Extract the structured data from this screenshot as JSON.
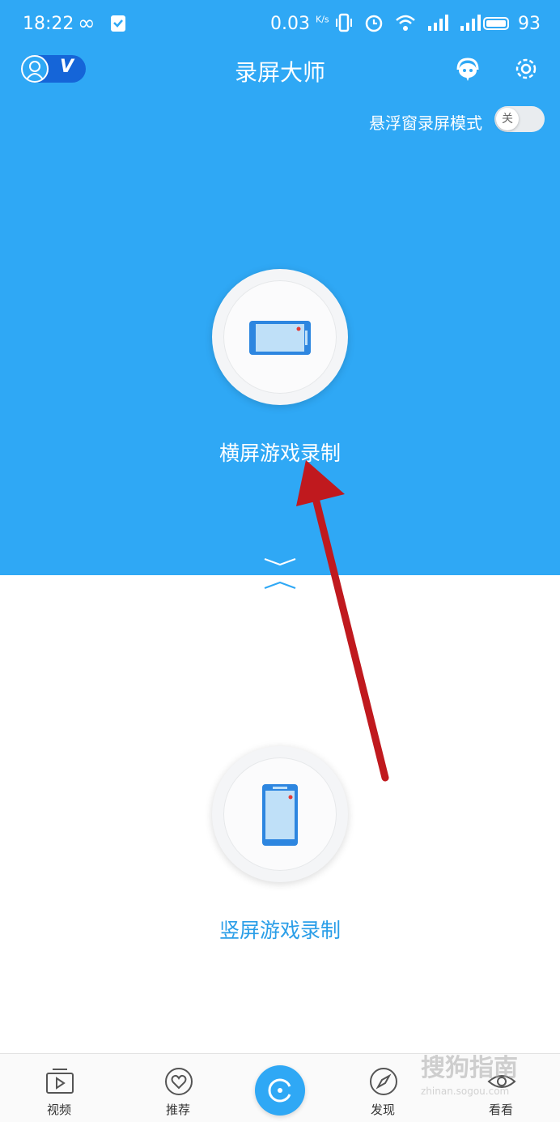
{
  "status_bar": {
    "time": "18:22",
    "speed": "0.03",
    "speed_unit": "K/s",
    "battery": "93"
  },
  "header": {
    "title": "录屏大师",
    "vip_badge": "V"
  },
  "float_mode": {
    "label": "悬浮窗录屏模式",
    "switch_state": "关"
  },
  "record": {
    "landscape_label": "横屏游戏录制",
    "portrait_label": "竖屏游戏录制"
  },
  "bottom_nav": {
    "items": [
      {
        "label": "视频",
        "icon": "video-icon"
      },
      {
        "label": "推荐",
        "icon": "heart-icon"
      },
      {
        "label": "",
        "icon": "record-icon"
      },
      {
        "label": "发现",
        "icon": "compass-icon"
      },
      {
        "label": "看看",
        "icon": "eye-icon"
      }
    ]
  },
  "watermark": {
    "text": "搜狗指南",
    "sub": "zhinan.sogou.com"
  },
  "colors": {
    "primary": "#2fa8f5",
    "annotation_arrow": "#c0191e",
    "portrait_label": "#2a9ee8"
  }
}
